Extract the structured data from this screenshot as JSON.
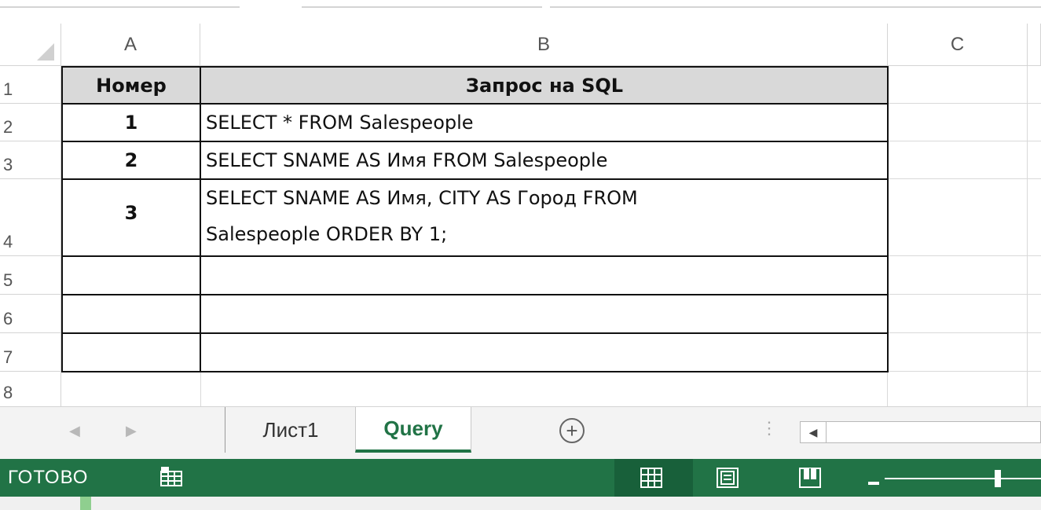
{
  "columns": [
    "A",
    "B",
    "C"
  ],
  "rows": [
    "1",
    "2",
    "3",
    "4",
    "5",
    "6",
    "7",
    "8"
  ],
  "table": {
    "header": {
      "number": "Номер",
      "query": "Запрос на SQL"
    },
    "rows": [
      {
        "number": "1",
        "query": "SELECT * FROM Salespeople"
      },
      {
        "number": "2",
        "query": "SELECT SNAME AS Имя FROM Salespeople"
      },
      {
        "number": "3",
        "query_line1": "SELECT SNAME AS Имя, CITY AS  Город FROM",
        "query_line2": "Salespeople  ORDER BY 1;"
      }
    ]
  },
  "sheet_tabs": [
    {
      "label": "Лист1",
      "active": false
    },
    {
      "label": "Query",
      "active": true
    }
  ],
  "status": {
    "ready_label": "ГОТОВО"
  },
  "colors": {
    "accent": "#217346",
    "header_fill": "#d9d9d9"
  },
  "icons": [
    "scroll-left-icon",
    "scroll-right-icon",
    "add-sheet-icon",
    "macro-record-icon",
    "normal-view-icon",
    "page-layout-view-icon",
    "page-break-view-icon",
    "zoom-out-icon",
    "zoom-slider"
  ]
}
